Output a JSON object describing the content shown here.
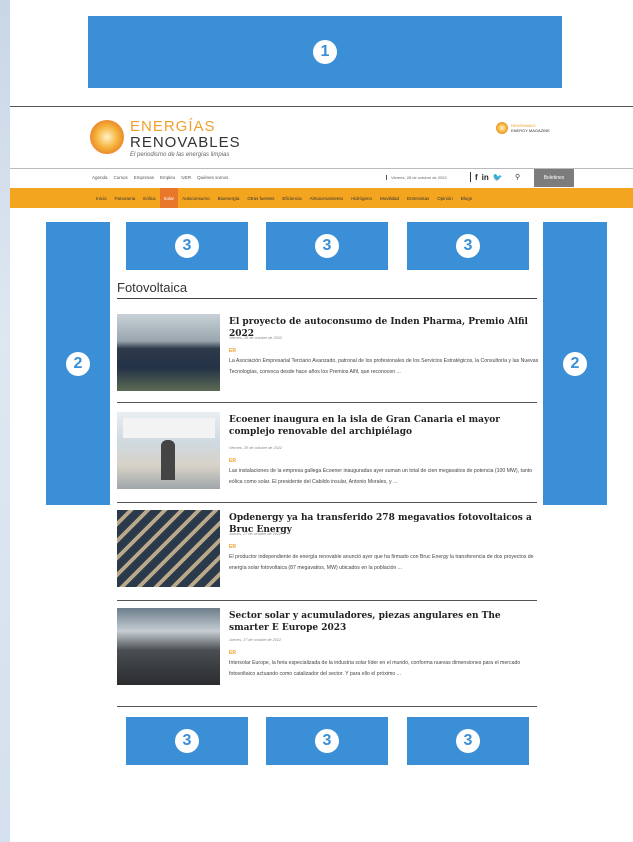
{
  "ads": {
    "top": "1",
    "left": "2",
    "right": "2",
    "upper_row": [
      "3",
      "3",
      "3"
    ],
    "lower_row": [
      "3",
      "3",
      "3"
    ]
  },
  "header": {
    "brand_line1": "ENERGÍAS",
    "brand_line2": "RENOVABLES",
    "tagline": "El periodismo de las energías limpias",
    "partner_line1": "RENEWABLE",
    "partner_line2": "ENERGY MAGAZINE"
  },
  "utility_nav": {
    "links": [
      "Agenda",
      "Cursos",
      "Empresas",
      "Empleo",
      "tvER",
      "Quiénes somos"
    ],
    "date": "Viernes, 28 de octubre de 2022",
    "social": [
      "f",
      "in",
      "🐦"
    ],
    "newsletter": "Boletines"
  },
  "main_nav": {
    "items": [
      "Inicio",
      "Panorama",
      "Eólica",
      "Solar",
      "Autoconsumo",
      "Bioenergía",
      "Otras fuentes",
      "Eficiencia",
      "Almacenamiento",
      "Hidrógeno",
      "Movilidad",
      "Entrevistas",
      "Opinión",
      "Blogs"
    ],
    "active": "Solar"
  },
  "section": {
    "title": "Fotovoltaica"
  },
  "articles": [
    {
      "title": "El proyecto de autoconsumo de Inden Pharma, Premio Alfil 2022",
      "date": "Viernes, 28 de octubre de 2022",
      "author": "ER",
      "excerpt": "La Asociación Empresarial Terciario Avanzado, patronal de los profesionales de los Servicios Estratégicos, la Consultoría y las Nuevas Tecnologías, convoca desde hace años los Premios Alfil, que reconocen ..."
    },
    {
      "title": "Ecoener inaugura en la isla de Gran Canaria el mayor complejo renovable del archipiélago",
      "date": "Viernes, 28 de octubre de 2022",
      "author": "ER",
      "excerpt": "Las instalaciones de la empresa gallega Ecoener inauguradas ayer suman un total de cien megavatios de potencia (100 MW), tanto eólica como solar. El presidente del Cabildo insular, Antonio Morales, y ..."
    },
    {
      "title": "Opdenergy ya ha transferido 278 megavatios fotovoltaicos a Bruc Energy",
      "date": "Jueves, 27 de octubre de 2022",
      "author": "ER",
      "excerpt": "El productor independiente de energía renovable anunció ayer que ha firmado con Bruc Energy la transferencia de dos proyectos de energía solar fotovoltaica (87 megavatios, MW) ubicados en la población ..."
    },
    {
      "title": "Sector solar y acumuladores, piezas angulares en The smarter E Europe 2023",
      "date": "Jueves, 27 de octubre de 2022",
      "author": "ER",
      "excerpt": "Intersolar Europe, la feria especializada de la industria solar líder en el mundo, conforma nuevas dimensiones para el mercado fotovoltaico actuando como catalizador del sector. Y para ello el próximo ..."
    }
  ]
}
